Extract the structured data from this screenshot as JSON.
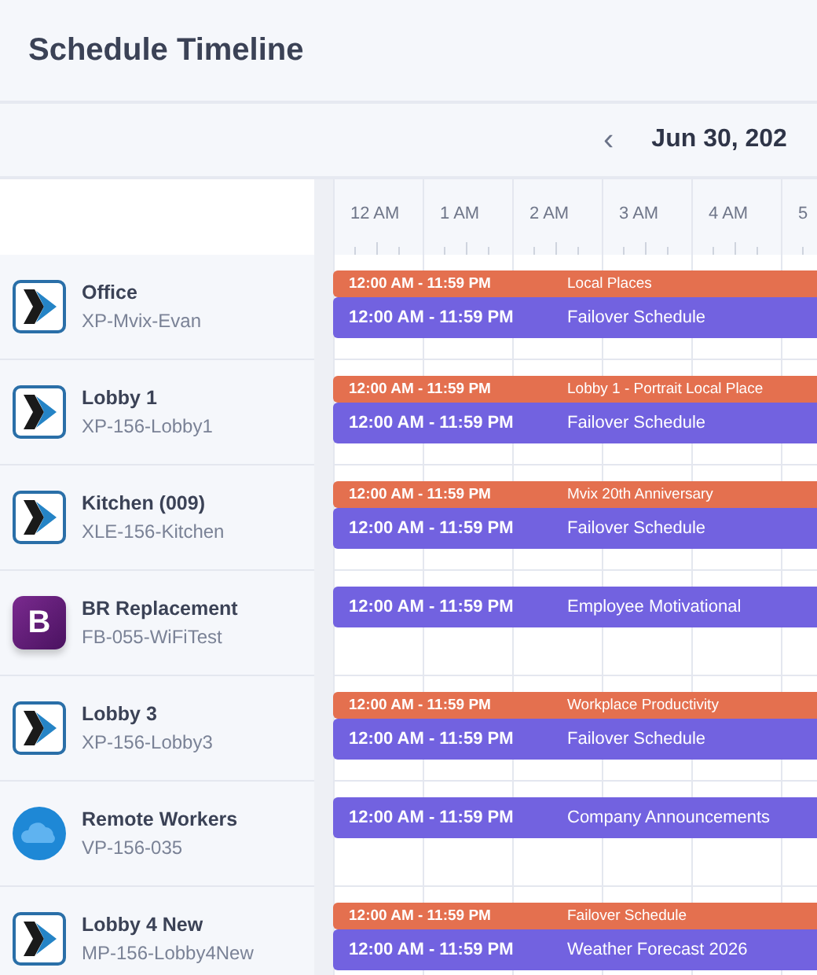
{
  "header": {
    "title": "Schedule Timeline"
  },
  "date_nav": {
    "prev": "‹",
    "date": "Jun 30, 202"
  },
  "hours": [
    "12 AM",
    "1 AM",
    "2 AM",
    "3 AM",
    "4 AM",
    "5"
  ],
  "devices": [
    {
      "name": "Office",
      "code": "XP-Mvix-Evan",
      "kind": "player",
      "events": [
        {
          "time": "12:00 AM - 11:59 PM",
          "title": "Local Places",
          "color": "#e4704f"
        },
        {
          "time": "12:00 AM - 11:59 PM",
          "title": "Failover Schedule",
          "color": "#7262e0"
        }
      ]
    },
    {
      "name": "Lobby 1",
      "code": "XP-156-Lobby1",
      "kind": "player",
      "events": [
        {
          "time": "12:00 AM - 11:59 PM",
          "title": "Lobby 1 - Portrait Local Place",
          "color": "#e4704f"
        },
        {
          "time": "12:00 AM - 11:59 PM",
          "title": "Failover Schedule",
          "color": "#7262e0"
        }
      ]
    },
    {
      "name": "Kitchen (009)",
      "code": "XLE-156-Kitchen",
      "kind": "player",
      "events": [
        {
          "time": "12:00 AM - 11:59 PM",
          "title": "Mvix 20th Anniversary",
          "color": "#e4704f"
        },
        {
          "time": "12:00 AM - 11:59 PM",
          "title": "Failover Schedule",
          "color": "#7262e0"
        }
      ]
    },
    {
      "name": "BR Replacement",
      "code": "FB-055-WiFiTest",
      "kind": "app",
      "logo_text": "B",
      "events": [
        {
          "time": "12:00 AM - 11:59 PM",
          "title": "Employee Motivational",
          "color": "#7262e0"
        }
      ]
    },
    {
      "name": "Lobby 3",
      "code": "XP-156-Lobby3",
      "kind": "player",
      "events": [
        {
          "time": "12:00 AM - 11:59 PM",
          "title": "Workplace Productivity",
          "color": "#e4704f"
        },
        {
          "time": "12:00 AM - 11:59 PM",
          "title": "Failover Schedule",
          "color": "#7262e0"
        }
      ]
    },
    {
      "name": "Remote Workers",
      "code": "VP-156-035",
      "kind": "cloud",
      "events": [
        {
          "time": "12:00 AM - 11:59 PM",
          "title": "Company Announcements",
          "color": "#7262e0"
        }
      ]
    },
    {
      "name": "Lobby 4 New",
      "code": "MP-156-Lobby4New",
      "kind": "player",
      "events": [
        {
          "time": "12:00 AM - 11:59 PM",
          "title": "Failover Schedule",
          "color": "#e4704f"
        },
        {
          "time": "12:00 AM - 11:59 PM",
          "title": "Weather Forecast 2026",
          "color": "#7262e0"
        }
      ]
    }
  ]
}
